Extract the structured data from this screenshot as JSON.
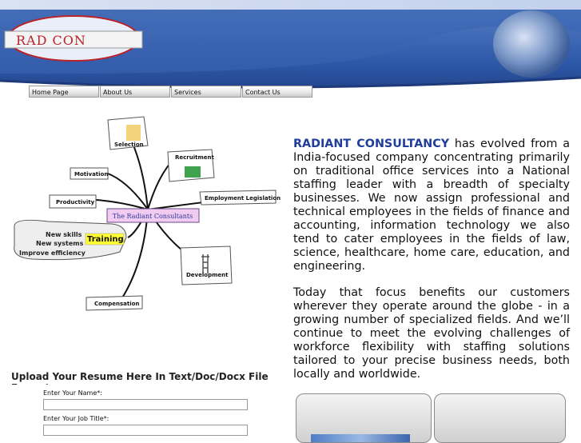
{
  "header": {
    "logo_text": "RAD CON",
    "colors": {
      "band_dark": "#1f3a7a",
      "band_mid": "#2d58a8",
      "band_light": "#c7d4ef",
      "logo_red": "#b8232a"
    }
  },
  "nav": {
    "items": [
      {
        "label": "Home Page"
      },
      {
        "label": "About Us"
      },
      {
        "label": "Services"
      },
      {
        "label": "Contact Us"
      }
    ]
  },
  "mindmap": {
    "center": "The Radiant Consultants",
    "nodes": {
      "selection": "Selection",
      "recruitment": "Recruitment",
      "motivation": "Motivation",
      "productivity": "Productivity",
      "employment_legislation": "Employment Legislation",
      "training": "Training",
      "new_skills": "New skills",
      "new_systems": "New systems",
      "improve_efficiency": "Improve efficiency",
      "development": "Development",
      "compensation": "Compensation"
    }
  },
  "content": {
    "brand": "RADIANT CONSULTANCY",
    "para1_rest": " has evolved from a India-focused company concentrating primarily on traditional office services into a National staffing leader with a breadth of specialty businesses. We now assign professional and technical employees in the fields of finance and accounting, information technology we also tend to cater employees in the fields of law, science, healthcare, home care, education, and engineering.",
    "para2": "Today that focus benefits our customers wherever they operate around the globe - in a growing number of specialized fields. And we’ll continue to meet the evolving challenges of workforce flexibility with staffing solutions tailored to your precise business needs, both locally and worldwide."
  },
  "upload": {
    "title": "Upload Your Resume Here In Text/Doc/Docx File Format",
    "name_label": "Enter Your Name*:",
    "name_value": "",
    "job_label": "Enter Your Job Title*:",
    "job_value": ""
  }
}
